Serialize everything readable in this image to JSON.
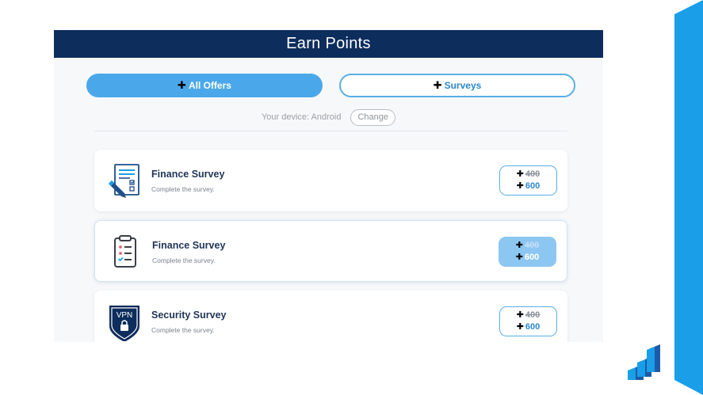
{
  "header": {
    "title": "Earn Points"
  },
  "tabs": [
    {
      "label": "All Offers",
      "active": true
    },
    {
      "label": "Surveys",
      "active": false
    }
  ],
  "device": {
    "label": "Your device: Android",
    "change_label": "Change"
  },
  "offers": [
    {
      "title": "Finance Survey",
      "description": "Complete the survey.",
      "old_points": "400",
      "new_points": "600",
      "icon": "survey-document-icon"
    },
    {
      "title": "Finance Survey",
      "description": "Complete the survey.",
      "old_points": "400",
      "new_points": "600",
      "icon": "clipboard-checklist-icon"
    },
    {
      "title": "Security Survey",
      "description": "Complete the survey.",
      "old_points": "400",
      "new_points": "600",
      "icon": "vpn-shield-icon",
      "icon_text": "VPN"
    }
  ],
  "colors": {
    "header": "#0d2d5c",
    "accent": "#4aa8ea",
    "stripe": "#1a9ee8"
  }
}
